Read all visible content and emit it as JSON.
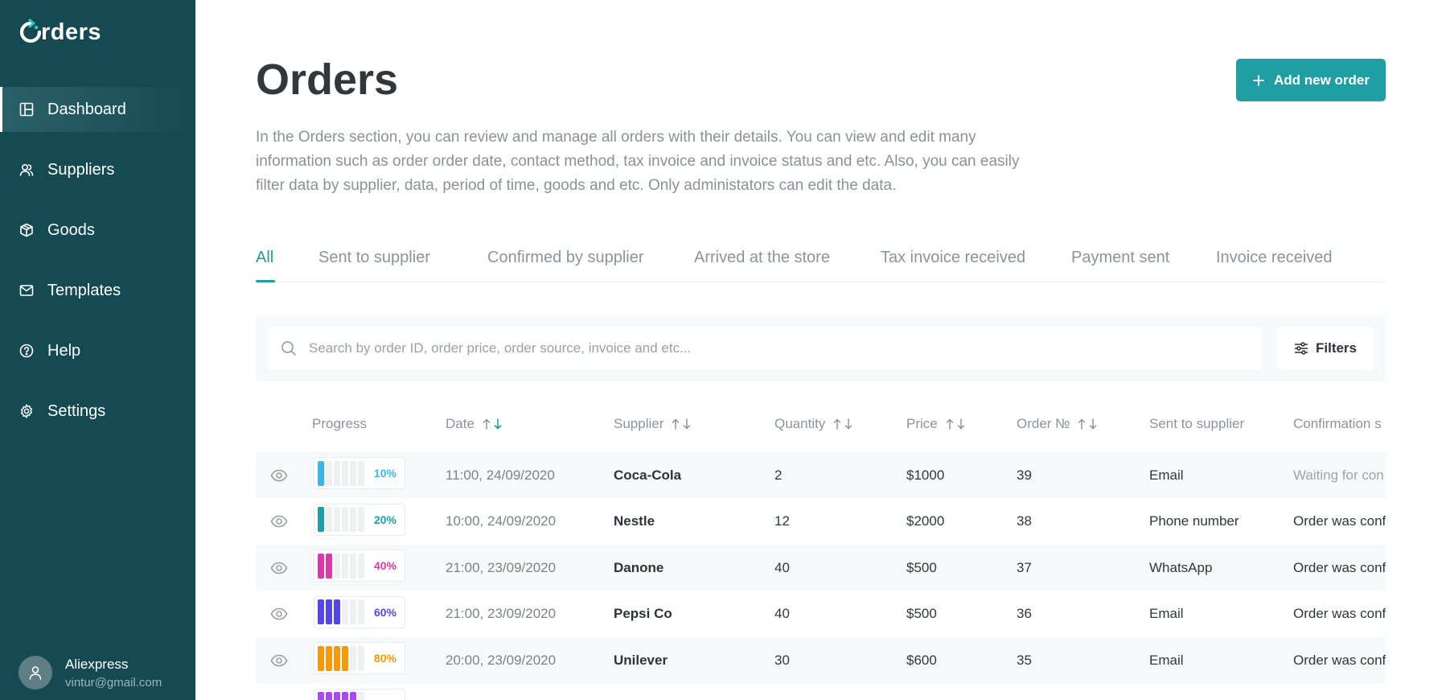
{
  "app": {
    "logo_text": "rders"
  },
  "sidebar": {
    "items": [
      {
        "label": "Dashboard",
        "icon": "dashboard-icon"
      },
      {
        "label": "Suppliers",
        "icon": "users-icon"
      },
      {
        "label": "Goods",
        "icon": "box-icon"
      },
      {
        "label": "Templates",
        "icon": "mail-icon"
      },
      {
        "label": "Help",
        "icon": "help-icon"
      },
      {
        "label": "Settings",
        "icon": "gear-icon"
      }
    ],
    "active": "Dashboard",
    "user": {
      "name": "Aliexpress",
      "email": "vintur@gmail.com"
    }
  },
  "header": {
    "title": "Orders",
    "add_button": "Add new order",
    "description": "In the Orders section, you can review and manage all orders with their details. You can view and edit many information such as order order date, contact method, tax invoice and invoice status and etc. Also, you can easily filter data by supplier, data, period of time, goods and etc. Only administators can edit the data."
  },
  "tabs": [
    "All",
    "Sent to supplier",
    "Confirmed by supplier",
    "Arrived at the store",
    "Tax invoice received",
    "Payment sent",
    "Invoice received"
  ],
  "active_tab": "All",
  "search": {
    "placeholder": "Search by order ID, order price, order source, invoice and etc...",
    "value": "",
    "filters_label": "Filters"
  },
  "table": {
    "columns": [
      "Progress",
      "Date",
      "Supplier",
      "Quantity",
      "Price",
      "Order №",
      "Sent to supplier",
      "Confirmation s"
    ],
    "rows": [
      {
        "progress": "10%",
        "progress_value": 0.1,
        "color": "#3cb6ea",
        "date": "11:00, 24/09/2020",
        "supplier": "Coca-Cola",
        "quantity": "2",
        "price": "$1000",
        "order_no": "39",
        "sent_to_supplier": "Email",
        "confirmation": "Waiting for con"
      },
      {
        "progress": "20%",
        "progress_value": 0.2,
        "color": "#1f9ea4",
        "date": "10:00, 24/09/2020",
        "supplier": "Nestle",
        "quantity": "12",
        "price": "$2000",
        "order_no": "38",
        "sent_to_supplier": "Phone number",
        "confirmation": "Order was conf"
      },
      {
        "progress": "40%",
        "progress_value": 0.4,
        "color": "#d93aa9",
        "date": "21:00, 23/09/2020",
        "supplier": "Danone",
        "quantity": "40",
        "price": "$500",
        "order_no": "37",
        "sent_to_supplier": "WhatsApp",
        "confirmation": "Order was conf"
      },
      {
        "progress": "60%",
        "progress_value": 0.6,
        "color": "#5446e5",
        "date": "21:00, 23/09/2020",
        "supplier": "Pepsi Co",
        "quantity": "40",
        "price": "$500",
        "order_no": "36",
        "sent_to_supplier": "Email",
        "confirmation": "Order was conf"
      },
      {
        "progress": "80%",
        "progress_value": 0.8,
        "color": "#f59a0e",
        "date": "20:00, 23/09/2020",
        "supplier": "Unilever",
        "quantity": "30",
        "price": "$600",
        "order_no": "35",
        "sent_to_supplier": "Email",
        "confirmation": "Order was conf"
      },
      {
        "progress": "",
        "progress_value": 1.0,
        "color": "#a94be8",
        "date": "",
        "supplier": "",
        "quantity": "",
        "price": "",
        "order_no": "",
        "sent_to_supplier": "",
        "confirmation": ""
      }
    ]
  },
  "colors": {
    "sidebar": "#154a53",
    "accent": "#1f9ea4",
    "row_alt": "#f7f8f9"
  }
}
